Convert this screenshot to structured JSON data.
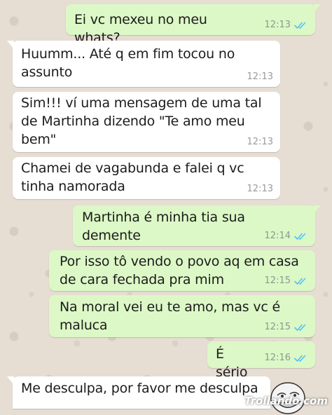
{
  "messages": [
    {
      "side": "out",
      "text": "Ei vc mexeu no meu whats?",
      "time": "12:13",
      "read": true
    },
    {
      "side": "in",
      "text": "Huumm...   Até q em fim tocou no\nassunto",
      "time": "12:13"
    },
    {
      "side": "in",
      "text": "Sim!!! ví uma mensagem de uma tal\nde Martinha dizendo \"Te amo meu\nbem\"",
      "time": "12:13"
    },
    {
      "side": "in",
      "text": "Chamei de vagabunda e falei q vc\ntinha namorada",
      "time": "12:13"
    },
    {
      "side": "out",
      "text": "Martinha é minha tia sua demente",
      "time": "12:14",
      "read": true
    },
    {
      "side": "out",
      "text": "Por isso tô vendo o povo aq em casa\nde cara fechada pra mim",
      "time": "12:15",
      "read": true
    },
    {
      "side": "out",
      "text": "Na moral vei eu te amo, mas vc é\nmaluca",
      "time": "12:15",
      "read": true
    },
    {
      "side": "out",
      "text": "É sério",
      "time": "12:16",
      "read": true
    },
    {
      "side": "in",
      "text": "Me desculpa, por favor me desculpa",
      "time": ""
    }
  ],
  "colors": {
    "outgoing_bubble": "#dcf8c6",
    "incoming_bubble": "#ffffff",
    "read_ticks": "#4fc3f7",
    "wallpaper": "#e6ddd3"
  },
  "icons": {
    "read_receipt": "double-check-icon",
    "sticker": "troll-face-emoji"
  },
  "watermark": "Trollando.com"
}
